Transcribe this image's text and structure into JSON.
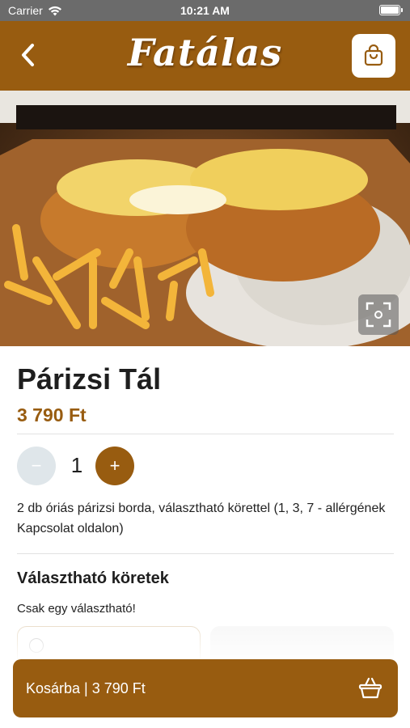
{
  "status_bar": {
    "carrier": "Carrier",
    "time": "10:21 AM"
  },
  "header": {
    "logo_text": "Fatálas",
    "back_icon": "chevron-left-icon",
    "cart_icon": "shopping-bag-icon"
  },
  "hero": {
    "alt": "Párizsi Tál",
    "fullscreen_icon": "fullscreen-icon"
  },
  "product": {
    "title": "Párizsi Tál",
    "price": "3 790 Ft",
    "quantity": "1",
    "minus_label": "−",
    "plus_label": "+",
    "description": "2 db óriás párizsi borda, választható körettel (1, 3, 7 - allérgének Kapcsolat oldalon)"
  },
  "sides": {
    "title": "Választható köretek",
    "subtitle": "Csak egy választható!"
  },
  "cta": {
    "label": "Kosárba | 3 790 Ft",
    "icon": "basket-icon"
  },
  "colors": {
    "brand": "#985c10",
    "status_bar": "#6b6b6b",
    "minus_bg": "#dfe6ea"
  }
}
